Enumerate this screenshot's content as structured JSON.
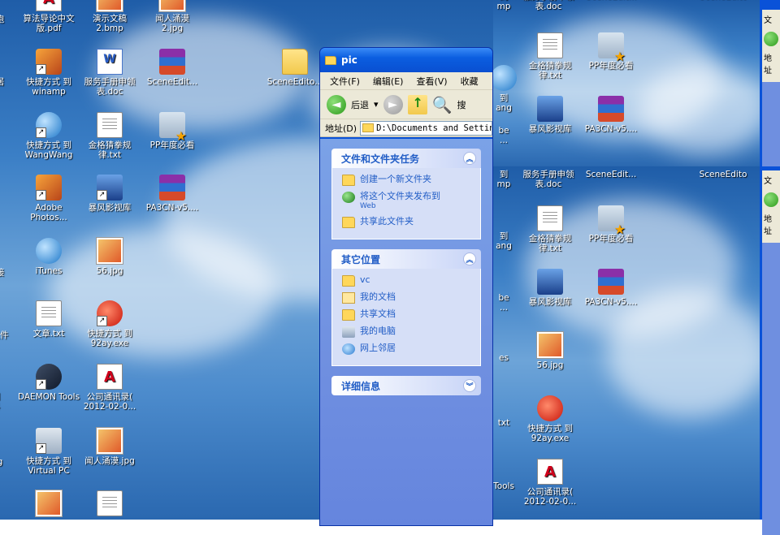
{
  "desktop_left": {
    "icons": [
      {
        "label": "算法导论中文\n版.pdf",
        "icon": "pdf-icon"
      },
      {
        "label": "演示文稿\n2.bmp",
        "icon": "image-icon"
      },
      {
        "label": "闻人涌漠\n2.jpg",
        "icon": "image-icon"
      },
      {
        "label": "快捷方式 到\nwinamp",
        "icon": "winamp-icon"
      },
      {
        "label": "服务手册申领\n表.doc",
        "icon": "word-doc-icon"
      },
      {
        "label": "SceneEdit...",
        "icon": "winrar-icon"
      },
      {
        "label": "SceneEdito...",
        "icon": "folder-icon"
      },
      {
        "label": "快捷方式 到\nWangWang",
        "icon": "wangwang-icon"
      },
      {
        "label": "金格猜拳规\n律.txt",
        "icon": "text-file-icon"
      },
      {
        "label": "PP年度必看",
        "icon": "favorite-folder-icon"
      },
      {
        "label": "Adobe\nPhotos...",
        "icon": "photoshop-icon"
      },
      {
        "label": "暴风影视库",
        "icon": "video-library-icon"
      },
      {
        "label": "PA3CN-v5....",
        "icon": "winrar-icon"
      },
      {
        "label": "iTunes",
        "icon": "itunes-icon"
      },
      {
        "label": "56.jpg",
        "icon": "image-icon"
      },
      {
        "label": "文章.txt",
        "icon": "text-file-icon"
      },
      {
        "label": "快捷方式 到\n92ay.exe",
        "icon": "ie-icon"
      },
      {
        "label": "DAEMON Tools",
        "icon": "daemon-tools-icon"
      },
      {
        "label": "公司通讯录(\n2012-02-0...",
        "icon": "pdf-icon"
      },
      {
        "label": "快捷方式 到\nVirtual PC",
        "icon": "virtual-pc-icon"
      },
      {
        "label": "闻人涌漠.jpg",
        "icon": "image-icon"
      },
      {
        "label": "",
        "icon": "image-icon"
      },
      {
        "label": "",
        "icon": "text-file-icon"
      }
    ],
    "edge_fragments": [
      "跑",
      "居",
      "",
      "",
      "接",
      "文件",
      "到\n科",
      "g"
    ]
  },
  "explorer": {
    "title": "pic",
    "menu": [
      "文件(F)",
      "编辑(E)",
      "查看(V)",
      "收藏"
    ],
    "toolbar": {
      "back_label": "后退",
      "back_arrow": "◄",
      "fwd_arrow": "►",
      "dropdown": "▾",
      "search_label": "搜"
    },
    "address_label": "地址(D)",
    "address_value": "D:\\Documents and Settings",
    "panels": [
      {
        "title": "文件和文件夹任务",
        "chev": "︽",
        "items": [
          {
            "label": "创建一个新文件夹",
            "sub": ""
          },
          {
            "label": "将这个文件夹发布到",
            "sub": "Web"
          },
          {
            "label": "共享此文件夹",
            "sub": ""
          }
        ]
      },
      {
        "title": "其它位置",
        "chev": "︽",
        "items": [
          {
            "label": "vc",
            "sub": ""
          },
          {
            "label": "我的文档",
            "sub": ""
          },
          {
            "label": "共享文档",
            "sub": ""
          },
          {
            "label": "我的电脑",
            "sub": ""
          },
          {
            "label": "网上邻居",
            "sub": ""
          }
        ]
      },
      {
        "title": "详细信息",
        "chev": "︾",
        "items": []
      }
    ]
  },
  "desktop_right_top": {
    "labels": [
      "到\nmp",
      "服务手册申领\n表.doc",
      "SceneEdit...",
      "SceneEdito",
      "到\nang",
      "金格猜拳规\n律.txt",
      "PP年度必看",
      "be\n...",
      "暴风影视库",
      "PA3CN-v5...."
    ]
  },
  "desktop_right_bottom": {
    "labels": [
      "到\nmp",
      "服务手册申领\n表.doc",
      "SceneEdit...",
      "SceneEdito",
      "到\nang",
      "金格猜拳规\n律.txt",
      "PP年度必看",
      "be\n...",
      "暴风影视库",
      "PA3CN-v5....",
      "es",
      "56.jpg",
      "txt",
      "快捷方式 到\n92ay.exe",
      "Tools",
      "公司通讯录(\n2012-02-0..."
    ]
  },
  "right_window": {
    "menu_fragment": "文",
    "address_fragment": "地址"
  }
}
